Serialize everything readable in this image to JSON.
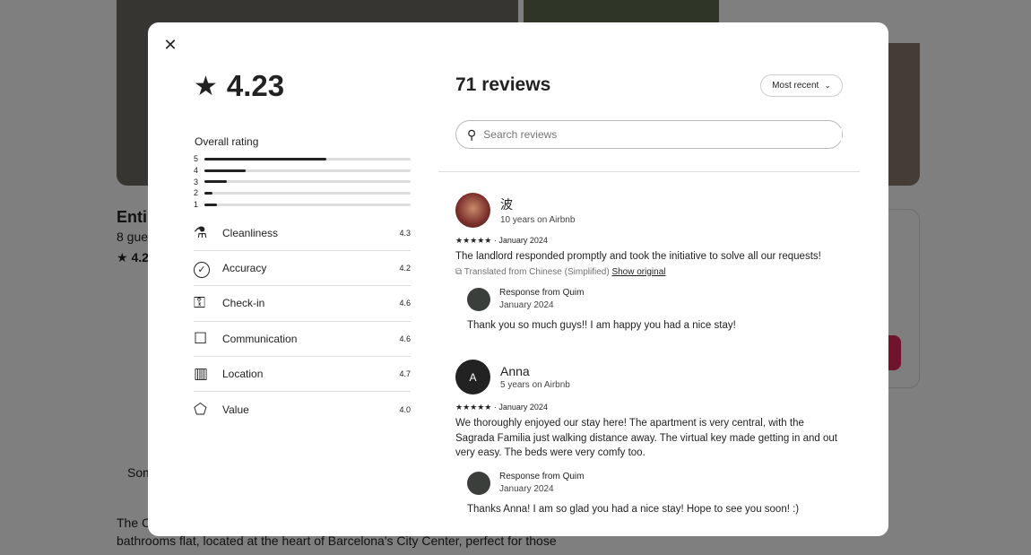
{
  "background": {
    "title_partial": "Enti",
    "guests_partial": "8 gues",
    "rating_partial": "★ 4.2",
    "some_partial": "Som",
    "desc_line1_partial": "The C",
    "desc_line2": "bathrooms flat, located at the heart of Barcelona's City Center, perfect for those"
  },
  "modal": {
    "close_icon": "close-icon",
    "overall_score": "4.23",
    "overall_rating_label": "Overall rating",
    "distribution": [
      {
        "stars": "5",
        "fraction": 0.59
      },
      {
        "stars": "4",
        "fraction": 0.2
      },
      {
        "stars": "3",
        "fraction": 0.11
      },
      {
        "stars": "2",
        "fraction": 0.04
      },
      {
        "stars": "1",
        "fraction": 0.06
      }
    ],
    "categories": [
      {
        "label": "Cleanliness",
        "value": "4.3",
        "icon": "spray-bottle-icon"
      },
      {
        "label": "Accuracy",
        "value": "4.2",
        "icon": "check-circle-icon"
      },
      {
        "label": "Check-in",
        "value": "4.6",
        "icon": "key-icon"
      },
      {
        "label": "Communication",
        "value": "4.6",
        "icon": "chat-bubble-icon"
      },
      {
        "label": "Location",
        "value": "4.7",
        "icon": "map-icon"
      },
      {
        "label": "Value",
        "value": "4.0",
        "icon": "tag-icon"
      }
    ],
    "reviews_count": "71 reviews",
    "sort_label": "Most recent",
    "search_placeholder": "Search reviews",
    "reviews": [
      {
        "name": "波",
        "tenure": "10 years on Airbnb",
        "stars": "★★★★★",
        "date": "· January 2024",
        "text": "The landlord responded promptly and took the initiative to solve all our requests!",
        "translation_note": "Translated from Chinese (Simplified)",
        "show_original": "Show original",
        "response": {
          "from": "Response from Quim",
          "date": "January 2024",
          "text": "Thank you so much guys!! I am happy you had a nice stay!"
        }
      },
      {
        "name": "Anna",
        "initial": "A",
        "tenure": "5 years on Airbnb",
        "stars": "★★★★★",
        "date": "· January 2024",
        "text": "We thoroughly enjoyed our stay here! The apartment is very central, with the Sagrada Familia just walking distance away. The virtual key made getting in and out very easy. The beds were very comfy too.",
        "response": {
          "from": "Response from Quim",
          "date": "January 2024",
          "text": "Thanks Anna! I am so glad you had a nice stay! Hope to see you soon! :)"
        }
      }
    ]
  }
}
